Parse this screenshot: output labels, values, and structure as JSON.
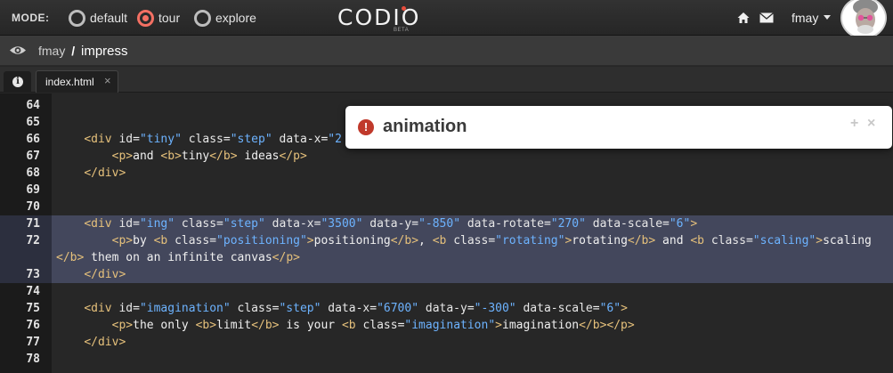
{
  "topbar": {
    "mode_label": "MODE:",
    "modes": [
      {
        "label": "default",
        "selected": false
      },
      {
        "label": "tour",
        "selected": true
      },
      {
        "label": "explore",
        "selected": false
      }
    ],
    "logo_text": "CODIO",
    "logo_badge": "BETA",
    "user": "fmay",
    "accent": "#f47063"
  },
  "breadcrumb": {
    "user": "fmay",
    "separator": "/",
    "project": "impress"
  },
  "tabs": {
    "file": "index.html",
    "close": "×"
  },
  "popover": {
    "title": "animation",
    "plus": "+",
    "close": "×"
  },
  "editor": {
    "selected_lines": [
      "71",
      "72",
      "73"
    ],
    "lines": [
      {
        "n": "64",
        "code": ""
      },
      {
        "n": "65",
        "code": ""
      },
      {
        "n": "66",
        "code": "    <div id=\"tiny\" class=\"step\" data-x=\"2"
      },
      {
        "n": "67",
        "code": "        <p>and <b>tiny</b> ideas</p>"
      },
      {
        "n": "68",
        "code": "    </div>"
      },
      {
        "n": "69",
        "code": ""
      },
      {
        "n": "70",
        "code": ""
      },
      {
        "n": "71",
        "code": "    <div id=\"ing\" class=\"step\" data-x=\"3500\" data-y=\"-850\" data-rotate=\"270\" data-scale=\"6\">"
      },
      {
        "n": "72",
        "code": "        <p>by <b class=\"positioning\">positioning</b>, <b class=\"rotating\">rotating</b> and <b class=\"scaling\">scaling"
      },
      {
        "n": "",
        "code": "</b> them on an infinite canvas</p>"
      },
      {
        "n": "73",
        "code": "    </div>"
      },
      {
        "n": "74",
        "code": ""
      },
      {
        "n": "75",
        "code": "    <div id=\"imagination\" class=\"step\" data-x=\"6700\" data-y=\"-300\" data-scale=\"6\">"
      },
      {
        "n": "76",
        "code": "        <p>the only <b>limit</b> is your <b class=\"imagination\">imagination</b></p>"
      },
      {
        "n": "77",
        "code": "    </div>"
      },
      {
        "n": "78",
        "code": ""
      }
    ]
  }
}
